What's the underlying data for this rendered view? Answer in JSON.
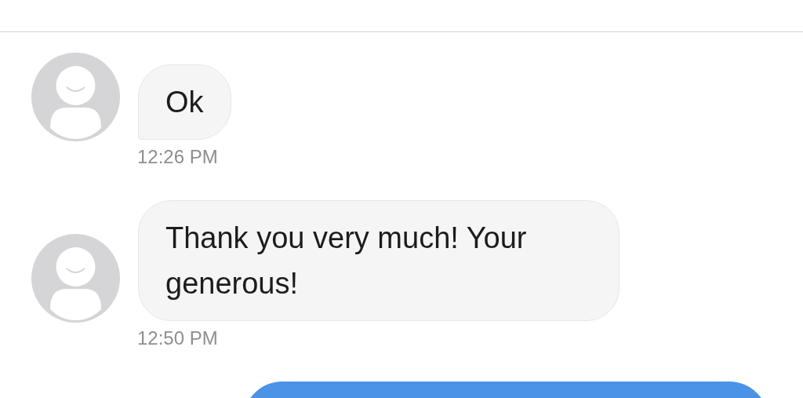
{
  "messages": [
    {
      "kind": "received",
      "text": "Ok",
      "tail": true,
      "time": "12:26 PM"
    },
    {
      "kind": "received",
      "text": "Thank you very much! Your generous!",
      "tail": false,
      "time": "12:50 PM"
    },
    {
      "kind": "sent"
    }
  ]
}
